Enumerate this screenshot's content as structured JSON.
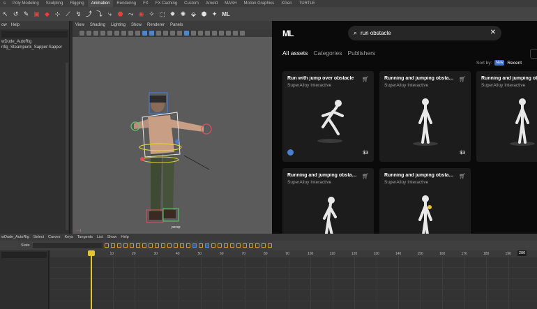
{
  "shelf": {
    "tabs": [
      "s",
      "Poly Modeling",
      "Sculpting",
      "Rigging",
      "Animation",
      "Rendering",
      "FX",
      "FX Caching",
      "Custom",
      "Arnold",
      "MASH",
      "Motion Graphics",
      "XGen",
      "TURTLE"
    ],
    "active_tab": 4,
    "shelf_logo": "ML"
  },
  "outliner": {
    "menu": [
      "ow",
      "Help"
    ],
    "items": [
      "wDude_AutoRig",
      "nfig_Steampunk_Sapper:Sapper"
    ]
  },
  "viewport": {
    "menu": [
      "View",
      "Shading",
      "Lighting",
      "Show",
      "Renderer",
      "Panels"
    ],
    "camera_label": "persp"
  },
  "ml_panel": {
    "logo": "ML",
    "search_value": "run obstacle",
    "tabs": [
      "All assets",
      "Categories",
      "Publishers"
    ],
    "active_tab": 0,
    "sort_label": "Sort by:",
    "sort_badge": "New",
    "sort_value": "Recent",
    "cards": [
      {
        "title": "Run with jump over obstacle",
        "publisher": "SuperAlloy Interactive",
        "price": "$3",
        "pose": "crouch"
      },
      {
        "title": "Running and jumping obstacl...",
        "publisher": "SuperAlloy Interactive",
        "price": "$3",
        "pose": "stand"
      },
      {
        "title": "Running and jumping obstacl...",
        "publisher": "SuperAlloy Interactive",
        "price": "",
        "pose": "stand"
      },
      {
        "title": "Running and jumping obstacl...",
        "publisher": "SuperAlloy Interactive",
        "price": "",
        "pose": "lean"
      },
      {
        "title": "Running and jumping obstacl...",
        "publisher": "SuperAlloy Interactive",
        "price": "",
        "pose": "stand-yellow"
      }
    ]
  },
  "graph_editor": {
    "menu": [
      "wDude_AutoRig",
      "Select",
      "Curves",
      "Keys",
      "Tangents",
      "List",
      "Show",
      "Help"
    ],
    "stats_label": "Stats",
    "ruler": [
      "10",
      "20",
      "30",
      "40",
      "50",
      "60",
      "70",
      "80",
      "90",
      "100",
      "110",
      "120",
      "130",
      "140",
      "150",
      "160",
      "170",
      "180",
      "190"
    ],
    "ruler_end": "200",
    "current_frame": "0"
  }
}
